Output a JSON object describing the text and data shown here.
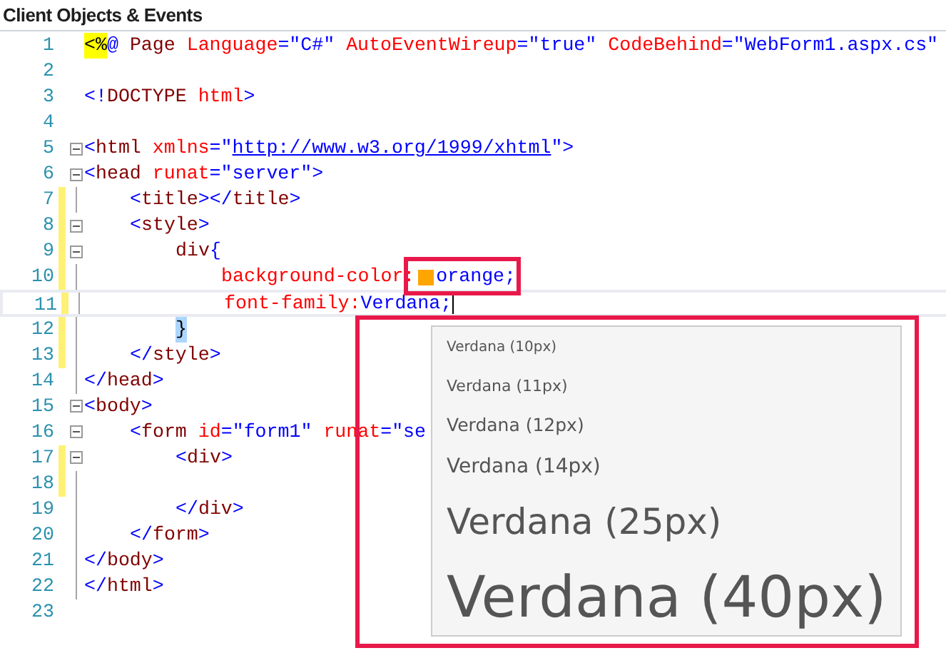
{
  "panel_title": "Client Objects & Events",
  "lines": [
    {
      "number": "1",
      "collapsible": false,
      "changed": false,
      "current": false,
      "tokens": [
        {
          "kind": "directive",
          "text": "<%"
        },
        {
          "kind": "punct",
          "text": "@ "
        },
        {
          "kind": "tag",
          "text": "Page "
        },
        {
          "kind": "attr",
          "text": "Language"
        },
        {
          "kind": "value",
          "text": "=\"C#\" "
        },
        {
          "kind": "attr",
          "text": "AutoEventWireup"
        },
        {
          "kind": "value",
          "text": "=\"true\" "
        },
        {
          "kind": "attr",
          "text": "CodeBehind"
        },
        {
          "kind": "value",
          "text": "=\"WebForm1.aspx.cs\""
        }
      ]
    },
    {
      "number": "2",
      "collapsible": false,
      "changed": false,
      "current": false
    },
    {
      "number": "3",
      "collapsible": false,
      "changed": false,
      "current": false,
      "tokens": [
        {
          "kind": "punct",
          "text": "<!"
        },
        {
          "kind": "tag",
          "text": "DOCTYPE "
        },
        {
          "kind": "attr",
          "text": "html"
        },
        {
          "kind": "punct",
          "text": ">"
        }
      ]
    },
    {
      "number": "4",
      "collapsible": false,
      "changed": false,
      "current": false
    },
    {
      "number": "5",
      "collapsible": true,
      "changed": false,
      "current": false,
      "tokens": [
        {
          "kind": "punct",
          "text": "<"
        },
        {
          "kind": "tag",
          "text": "html "
        },
        {
          "kind": "attr",
          "text": "xmlns"
        },
        {
          "kind": "punct",
          "text": "=\""
        },
        {
          "kind": "link",
          "text": "http://www.w3.org/1999/xhtml"
        },
        {
          "kind": "punct",
          "text": "\">"
        }
      ]
    },
    {
      "number": "6",
      "collapsible": true,
      "changed": false,
      "current": false,
      "tokens": [
        {
          "kind": "punct",
          "text": "<"
        },
        {
          "kind": "tag",
          "text": "head "
        },
        {
          "kind": "attr",
          "text": "runat"
        },
        {
          "kind": "value",
          "text": "=\"server\">"
        }
      ]
    },
    {
      "number": "7",
      "collapsible": false,
      "changed": true,
      "current": false,
      "tokens": [
        {
          "kind": "indent"
        },
        {
          "kind": "punct",
          "text": "<"
        },
        {
          "kind": "tag",
          "text": "title"
        },
        {
          "kind": "punct",
          "text": "></"
        },
        {
          "kind": "tag",
          "text": "title"
        },
        {
          "kind": "punct",
          "text": ">"
        }
      ]
    },
    {
      "number": "8",
      "collapsible": true,
      "changed": true,
      "current": false,
      "tokens": [
        {
          "kind": "indent"
        },
        {
          "kind": "punct",
          "text": "<"
        },
        {
          "kind": "tag",
          "text": "style"
        },
        {
          "kind": "punct",
          "text": ">"
        }
      ]
    },
    {
      "number": "9",
      "collapsible": true,
      "changed": true,
      "current": false,
      "tokens": [
        {
          "kind": "indent"
        },
        {
          "kind": "indent"
        },
        {
          "kind": "tag",
          "text": "div"
        },
        {
          "kind": "punct",
          "text": "{"
        }
      ]
    },
    {
      "number": "10",
      "collapsible": false,
      "changed": true,
      "current": false,
      "tokens": [
        {
          "kind": "indent"
        },
        {
          "kind": "indent"
        },
        {
          "kind": "indent"
        },
        {
          "kind": "attr",
          "text": "background-color:"
        },
        {
          "kind": "swatch",
          "color": "#ffa500"
        },
        {
          "kind": "value",
          "text": "orange;"
        }
      ]
    },
    {
      "number": "11",
      "collapsible": false,
      "changed": true,
      "current": true,
      "tokens": [
        {
          "kind": "indent"
        },
        {
          "kind": "indent"
        },
        {
          "kind": "indent"
        },
        {
          "kind": "attr",
          "text": "font-family:"
        },
        {
          "kind": "value",
          "text": "Verdana;"
        },
        {
          "kind": "caret"
        }
      ]
    },
    {
      "number": "12",
      "collapsible": false,
      "changed": true,
      "current": false,
      "tokens": [
        {
          "kind": "indent"
        },
        {
          "kind": "indent"
        },
        {
          "kind": "brace",
          "text": "}"
        }
      ]
    },
    {
      "number": "13",
      "collapsible": false,
      "changed": true,
      "current": false,
      "tokens": [
        {
          "kind": "indent"
        },
        {
          "kind": "punct",
          "text": "</"
        },
        {
          "kind": "tag",
          "text": "style"
        },
        {
          "kind": "punct",
          "text": ">"
        }
      ]
    },
    {
      "number": "14",
      "collapsible": false,
      "changed": false,
      "current": false,
      "tokens": [
        {
          "kind": "punct",
          "text": "</"
        },
        {
          "kind": "tag",
          "text": "head"
        },
        {
          "kind": "punct",
          "text": ">"
        }
      ]
    },
    {
      "number": "15",
      "collapsible": true,
      "changed": false,
      "current": false,
      "tokens": [
        {
          "kind": "punct",
          "text": "<"
        },
        {
          "kind": "tag",
          "text": "body"
        },
        {
          "kind": "punct",
          "text": ">"
        }
      ]
    },
    {
      "number": "16",
      "collapsible": true,
      "changed": false,
      "current": false,
      "tokens": [
        {
          "kind": "indent"
        },
        {
          "kind": "punct",
          "text": "<"
        },
        {
          "kind": "tag",
          "text": "form "
        },
        {
          "kind": "attr",
          "text": "id"
        },
        {
          "kind": "value",
          "text": "=\"form1\" "
        },
        {
          "kind": "attr",
          "text": "runat"
        },
        {
          "kind": "value",
          "text": "=\"se"
        }
      ]
    },
    {
      "number": "17",
      "collapsible": true,
      "changed": true,
      "current": false,
      "tokens": [
        {
          "kind": "indent"
        },
        {
          "kind": "indent"
        },
        {
          "kind": "punct",
          "text": "<"
        },
        {
          "kind": "tag",
          "text": "div"
        },
        {
          "kind": "punct",
          "text": ">"
        }
      ]
    },
    {
      "number": "18",
      "collapsible": false,
      "changed": true,
      "current": false
    },
    {
      "number": "19",
      "collapsible": false,
      "changed": false,
      "current": false,
      "tokens": [
        {
          "kind": "indent"
        },
        {
          "kind": "indent"
        },
        {
          "kind": "punct",
          "text": "</"
        },
        {
          "kind": "tag",
          "text": "div"
        },
        {
          "kind": "punct",
          "text": ">"
        }
      ]
    },
    {
      "number": "20",
      "collapsible": false,
      "changed": false,
      "current": false,
      "tokens": [
        {
          "kind": "indent"
        },
        {
          "kind": "punct",
          "text": "</"
        },
        {
          "kind": "tag",
          "text": "form"
        },
        {
          "kind": "punct",
          "text": ">"
        }
      ]
    },
    {
      "number": "21",
      "collapsible": false,
      "changed": false,
      "current": false,
      "tokens": [
        {
          "kind": "punct",
          "text": "</"
        },
        {
          "kind": "tag",
          "text": "body"
        },
        {
          "kind": "punct",
          "text": ">"
        }
      ]
    },
    {
      "number": "22",
      "collapsible": false,
      "changed": false,
      "current": false,
      "tokens": [
        {
          "kind": "punct",
          "text": "</"
        },
        {
          "kind": "tag",
          "text": "html"
        },
        {
          "kind": "punct",
          "text": ">"
        }
      ]
    },
    {
      "number": "23",
      "collapsible": false,
      "changed": false,
      "current": false
    }
  ],
  "font_popup": {
    "items": [
      "Verdana (10px)",
      "Verdana (11px)",
      "Verdana (12px)",
      "Verdana (14px)",
      "Verdana (25px)",
      "Verdana (40px)"
    ]
  }
}
